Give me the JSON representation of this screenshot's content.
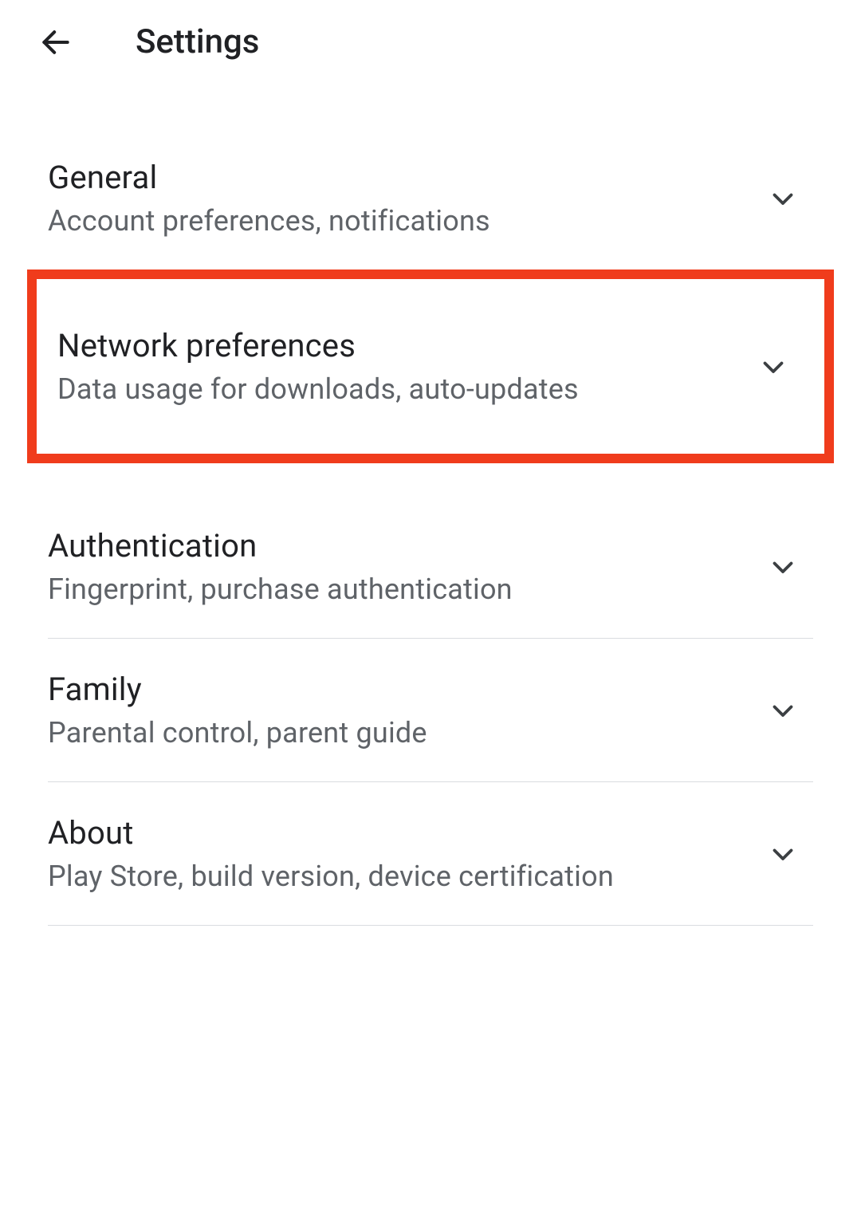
{
  "header": {
    "title": "Settings"
  },
  "settings": {
    "items": [
      {
        "title": "General",
        "subtitle": "Account preferences, notifications"
      },
      {
        "title": "Network preferences",
        "subtitle": "Data usage for downloads, auto-updates"
      },
      {
        "title": "Authentication",
        "subtitle": "Fingerprint, purchase authentication"
      },
      {
        "title": "Family",
        "subtitle": "Parental control, parent guide"
      },
      {
        "title": "About",
        "subtitle": "Play Store, build version, device certification"
      }
    ]
  }
}
